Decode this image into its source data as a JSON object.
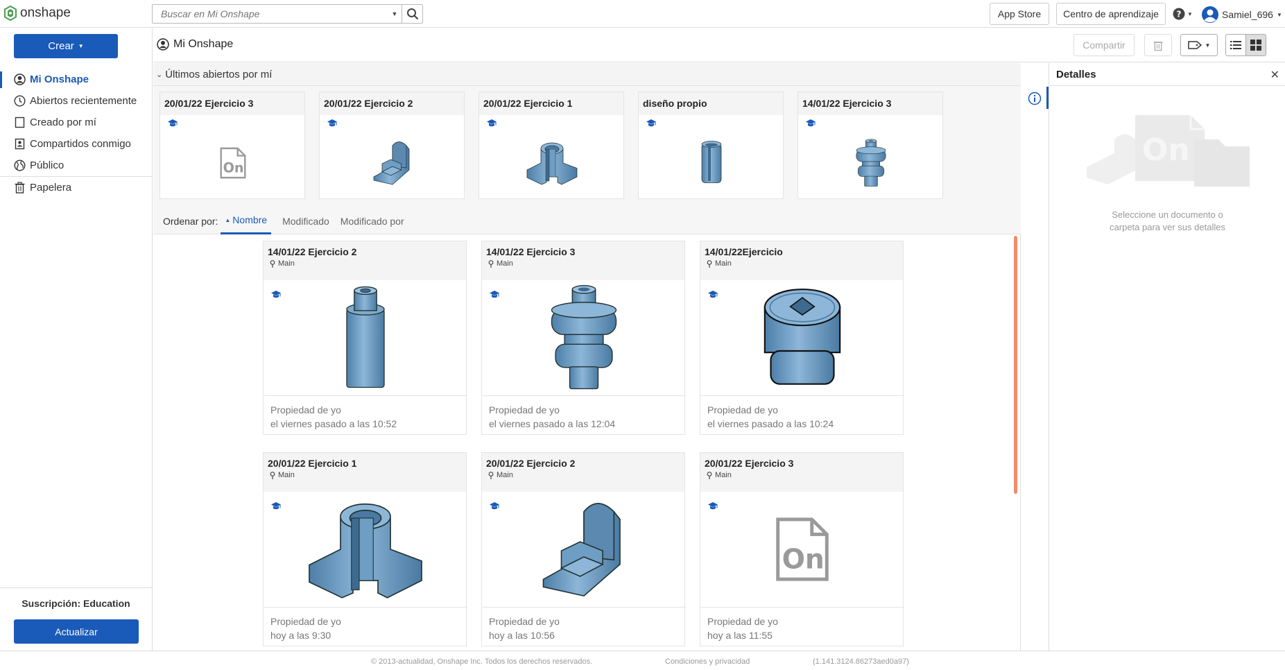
{
  "topbar": {
    "logo_text": "onshape",
    "search_placeholder": "Buscar en Mi Onshape",
    "app_store": "App Store",
    "learning_center": "Centro de aprendizaje",
    "username": "Samiel_696"
  },
  "sidebar": {
    "create_label": "Crear",
    "items": [
      {
        "label": "Mi Onshape",
        "icon": "user-circle-icon"
      },
      {
        "label": "Abiertos recientemente",
        "icon": "clock-icon"
      },
      {
        "label": "Creado por mí",
        "icon": "document-icon"
      },
      {
        "label": "Compartidos conmigo",
        "icon": "shared-icon"
      },
      {
        "label": "Público",
        "icon": "globe-icon"
      },
      {
        "label": "Papelera",
        "icon": "trash-icon"
      }
    ],
    "subscription_label": "Suscripción:",
    "subscription_value": "Education",
    "upgrade_label": "Actualizar"
  },
  "header": {
    "title": "Mi Onshape",
    "share_label": "Compartir"
  },
  "recent": {
    "heading": "Últimos abiertos por mí",
    "cards": [
      {
        "title": "20/01/22 Ejercicio 3",
        "thumb": "onshape-doc"
      },
      {
        "title": "20/01/22 Ejercicio 2",
        "thumb": "bracket"
      },
      {
        "title": "20/01/22 Ejercicio 1",
        "thumb": "cut-flange"
      },
      {
        "title": "diseño propio",
        "thumb": "tube"
      },
      {
        "title": "14/01/22 Ejercicio 3",
        "thumb": "spool"
      }
    ]
  },
  "sort": {
    "label": "Ordenar por:",
    "options": [
      "Nombre",
      "Modificado",
      "Modificado por"
    ]
  },
  "documents": [
    {
      "title": "14/01/22 Ejercicio 2",
      "branch": "Main",
      "owner": "Propiedad de yo",
      "modified": "el viernes pasado a las 10:52",
      "thumb": "cylinder"
    },
    {
      "title": "14/01/22 Ejercicio 3",
      "branch": "Main",
      "owner": "Propiedad de yo",
      "modified": "el viernes pasado a las 12:04",
      "thumb": "spool"
    },
    {
      "title": "14/01/22Ejercicio",
      "branch": "Main",
      "owner": "Propiedad de yo",
      "modified": "el viernes pasado a las 10:24",
      "thumb": "socket-cap"
    },
    {
      "title": "20/01/22 Ejercicio 1",
      "branch": "Main",
      "owner": "Propiedad de yo",
      "modified": "hoy a las 9:30",
      "thumb": "cut-flange"
    },
    {
      "title": "20/01/22 Ejercicio 2",
      "branch": "Main",
      "owner": "Propiedad de yo",
      "modified": "hoy a las 10:56",
      "thumb": "bracket"
    },
    {
      "title": "20/01/22 Ejercicio 3",
      "branch": "Main",
      "owner": "Propiedad de yo",
      "modified": "hoy a las 11:55",
      "thumb": "onshape-doc"
    }
  ],
  "details": {
    "title": "Detalles",
    "empty_message_line1": "Seleccione un documento o",
    "empty_message_line2": "carpeta para ver sus detalles"
  },
  "footer": {
    "copyright": "© 2013-actualidad, Onshape Inc. Todos los derechos reservados.",
    "terms": "Condiciones y privacidad",
    "version": "(1.141.3124.86273aed0a97)"
  },
  "colors": {
    "accent": "#1a5ab8",
    "model": "#6f9ec4",
    "scroll": "#f28c6b"
  }
}
